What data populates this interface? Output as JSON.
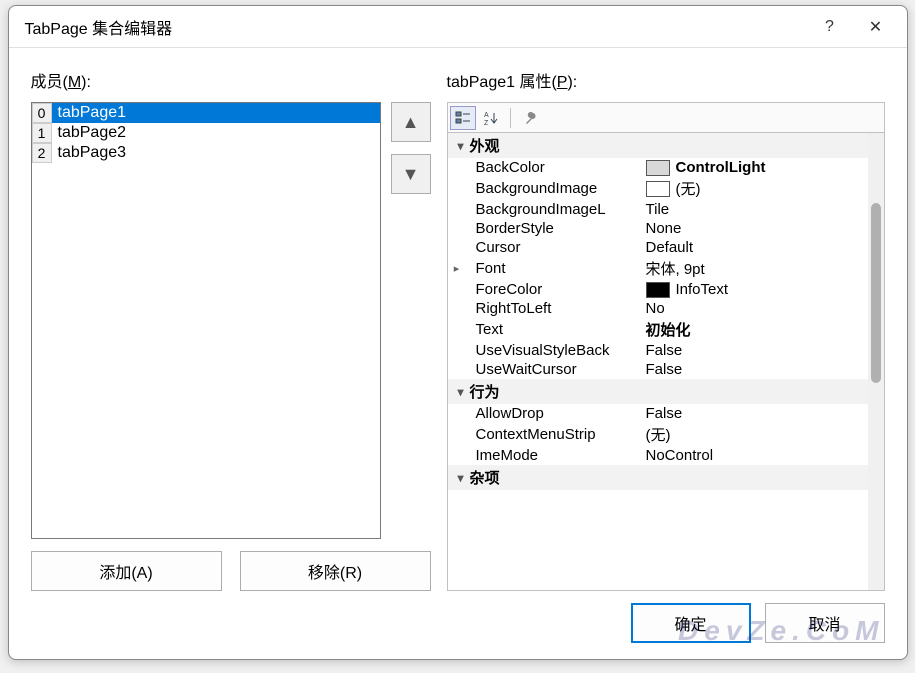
{
  "title": "TabPage 集合编辑器",
  "help_icon": "?",
  "close_icon": "✕",
  "members_label_pre": "成员(",
  "members_label_key": "M",
  "members_label_post": "):",
  "members": [
    {
      "index": "0",
      "name": "tabPage1",
      "selected": true
    },
    {
      "index": "1",
      "name": "tabPage2",
      "selected": false
    },
    {
      "index": "2",
      "name": "tabPage3",
      "selected": false
    }
  ],
  "move_up_icon": "▲",
  "move_down_icon": "▼",
  "add_label": "添加(A)",
  "remove_label": "移除(R)",
  "props_label_pre": "tabPage1 属性(",
  "props_label_key": "P",
  "props_label_post": "):",
  "toolbar": {
    "categorized_icon": "☷",
    "alpha_icon": "A↓Z",
    "props_page_icon": "🔧"
  },
  "categories": [
    {
      "name": "外观",
      "expanded": true,
      "rows": [
        {
          "name": "BackColor",
          "value": "ControlLight",
          "swatch": "#d8d8d8",
          "bold": true
        },
        {
          "name": "BackgroundImage",
          "value": "(无)",
          "swatch": "#ffffff"
        },
        {
          "name": "BackgroundImageLayout",
          "short": "BackgroundImageL",
          "value": "Tile"
        },
        {
          "name": "BorderStyle",
          "value": "None"
        },
        {
          "name": "Cursor",
          "value": "Default"
        },
        {
          "name": "Font",
          "value": "宋体, 9pt",
          "expandable": true
        },
        {
          "name": "ForeColor",
          "value": "InfoText",
          "swatch": "#000000"
        },
        {
          "name": "RightToLeft",
          "value": "No"
        },
        {
          "name": "Text",
          "value": "初始化",
          "bold": true
        },
        {
          "name": "UseVisualStyleBackColor",
          "short": "UseVisualStyleBack",
          "value": "False"
        },
        {
          "name": "UseWaitCursor",
          "value": "False"
        }
      ]
    },
    {
      "name": "行为",
      "expanded": true,
      "rows": [
        {
          "name": "AllowDrop",
          "value": "False"
        },
        {
          "name": "ContextMenuStrip",
          "value": "(无)"
        },
        {
          "name": "ImeMode",
          "value": "NoControl"
        }
      ]
    },
    {
      "name": "杂项",
      "expanded": true,
      "rows": []
    }
  ],
  "ok_label": "确定",
  "cancel_label": "取消",
  "watermark": "DevZe.CoM"
}
